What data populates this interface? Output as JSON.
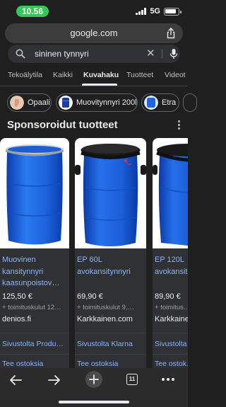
{
  "status_bar": {
    "time": "10.56",
    "network": "5G"
  },
  "browser": {
    "url": "google.com"
  },
  "search": {
    "query": "sininen tynnyri"
  },
  "tabs": [
    {
      "label": "Tekoälytila"
    },
    {
      "label": "Kaikki"
    },
    {
      "label": "Kuvahaku",
      "active": true
    },
    {
      "label": "Tuotteet"
    },
    {
      "label": "Videot"
    }
  ],
  "chips": [
    {
      "label": "Opaali"
    },
    {
      "label": "Muovitynnyri 200l"
    },
    {
      "label": "Etra"
    }
  ],
  "sponsored": {
    "title": "Sponsoroidut tuotteet",
    "cards": [
      {
        "title": "Muovinen kansitynnyri kaasunpoistov…",
        "price": "125,50 €",
        "shipping": "+ toimituskulut 12…",
        "store": "denios.fi",
        "link1": "Sivustolta Produ…",
        "link2": "Tee ostoksia"
      },
      {
        "title": "EP 60L avokansitynnyri",
        "price": "69,90 €",
        "shipping": "+ toimituskulut 9,…",
        "store": "Karkkainen.com",
        "link1": "Sivustolta Klarna",
        "link2": "Tee ostoksia"
      },
      {
        "title": "EP 120L avokansit…",
        "price": "89,90 €",
        "shipping": "+ toimitus…",
        "store": "Karkkaine…",
        "link1": "Sivustolta …",
        "link2": "Tee ostok…"
      }
    ]
  },
  "bottom_bar": {
    "tab_count": "11"
  },
  "colors": {
    "background": "#1f1f1f",
    "link": "#8ab4f8",
    "barrel_blue": "#1e66e0",
    "status_pill": "#34c759"
  }
}
